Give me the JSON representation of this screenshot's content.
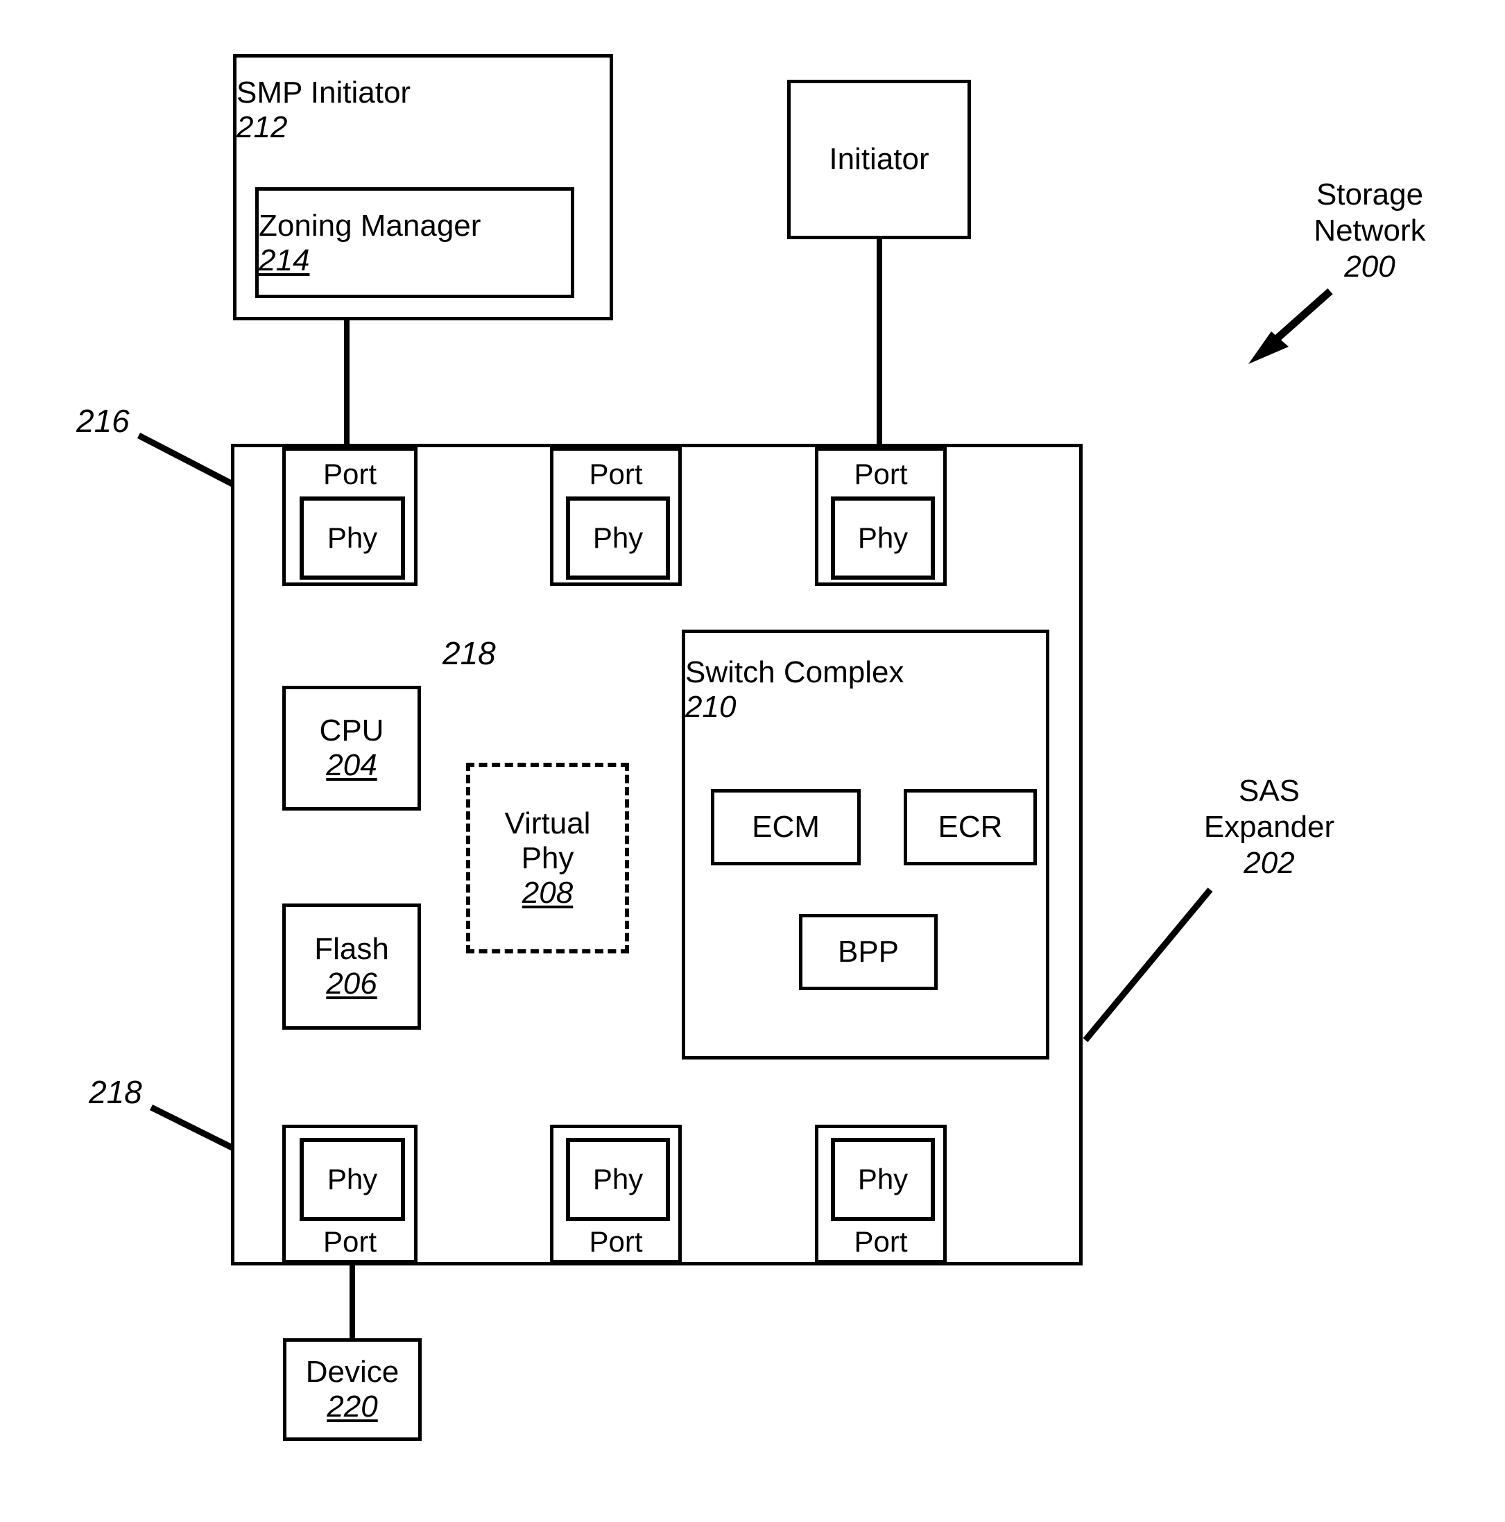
{
  "figure": {
    "type": "patent-block-diagram",
    "background": "#ffffff",
    "stroke": "#000000"
  },
  "smp_initiator": {
    "title": "SMP Initiator",
    "ref": "212",
    "zoning_manager": {
      "title": "Zoning Manager",
      "ref": "214"
    }
  },
  "initiator": {
    "title": "Initiator"
  },
  "storage_network": {
    "line1": "Storage",
    "line2": "Network",
    "ref": "200"
  },
  "sas_expander": {
    "line1": "SAS",
    "line2": "Expander",
    "ref": "202",
    "callouts": {
      "port_ref": "216",
      "phy_ref_top": "218",
      "phy_ref_bottom": "218"
    },
    "top_ports": [
      {
        "port_label": "Port",
        "phy_label": "Phy"
      },
      {
        "port_label": "Port",
        "phy_label": "Phy"
      },
      {
        "port_label": "Port",
        "phy_label": "Phy"
      }
    ],
    "bottom_ports": [
      {
        "phy_label": "Phy",
        "port_label": "Port"
      },
      {
        "phy_label": "Phy",
        "port_label": "Port"
      },
      {
        "phy_label": "Phy",
        "port_label": "Port"
      }
    ],
    "cpu": {
      "title": "CPU",
      "ref": "204"
    },
    "flash": {
      "title": "Flash",
      "ref": "206"
    },
    "virtual_phy": {
      "line1": "Virtual",
      "line2": "Phy",
      "ref": "208"
    },
    "switch_complex": {
      "title": "Switch Complex",
      "ref": "210",
      "blocks": [
        {
          "label": "ECM"
        },
        {
          "label": "ECR"
        },
        {
          "label": "BPP"
        }
      ]
    }
  },
  "device": {
    "title": "Device",
    "ref": "220"
  }
}
